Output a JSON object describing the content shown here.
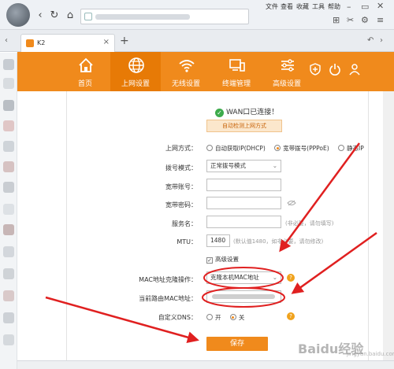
{
  "browser": {
    "menu": [
      "文件",
      "查看",
      "收藏",
      "工具",
      "帮助"
    ],
    "tab_title": "K2"
  },
  "router_nav": {
    "items": [
      {
        "label": "首页",
        "icon": "home-icon"
      },
      {
        "label": "上网设置",
        "icon": "globe-icon"
      },
      {
        "label": "无线设置",
        "icon": "wifi-icon"
      },
      {
        "label": "终端管理",
        "icon": "devices-icon"
      },
      {
        "label": "高级设置",
        "icon": "sliders-icon"
      }
    ],
    "active_index": 1,
    "colors": {
      "brand": "#f08a1c",
      "active": "#e77a06"
    }
  },
  "status": {
    "text": "WAN口已连接！",
    "detect_label": "自动检测上网方式"
  },
  "form": {
    "method_label": "上网方式：",
    "method_options": [
      "自动获取IP(DHCP)",
      "宽带拨号(PPPoE)",
      "静态IP"
    ],
    "method_selected": "宽带拨号(PPPoE)",
    "dial_mode_label": "拨号模式：",
    "dial_mode_value": "正常拨号模式",
    "account_label": "宽带账号：",
    "account_value": "",
    "password_label": "宽带密码：",
    "password_value": "",
    "service_label": "服务名：",
    "service_hint": "(非必要，请勿填写)",
    "mtu_label": "MTU：",
    "mtu_value": "1480",
    "mtu_hint": "(默认值1480，如非必要，请勿修改)",
    "advanced_label": "高级设置",
    "mac_clone_label": "MAC地址克隆操作：",
    "mac_clone_value": "克隆本机MAC地址",
    "current_mac_label": "当前路由MAC地址：",
    "dns_label": "自定义DNS：",
    "dns_on": "开",
    "dns_off": "关",
    "dns_selected": "关",
    "save_label": "保存"
  },
  "watermark": {
    "main": "Baidu经验",
    "sub": "jingyan.baidu.com"
  }
}
